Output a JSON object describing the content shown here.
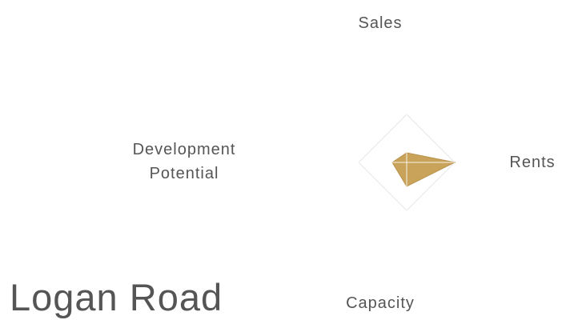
{
  "title": "Logan Road",
  "chart_data": {
    "type": "radar",
    "axes": [
      "Sales",
      "Rents",
      "Capacity",
      "Development Potential"
    ],
    "series": [
      {
        "values": [
          0.2,
          1.0,
          0.5,
          0.3
        ]
      }
    ],
    "range": [
      0,
      1
    ],
    "fill_color": "#c9a35a",
    "grid_color": "#ffffff"
  }
}
